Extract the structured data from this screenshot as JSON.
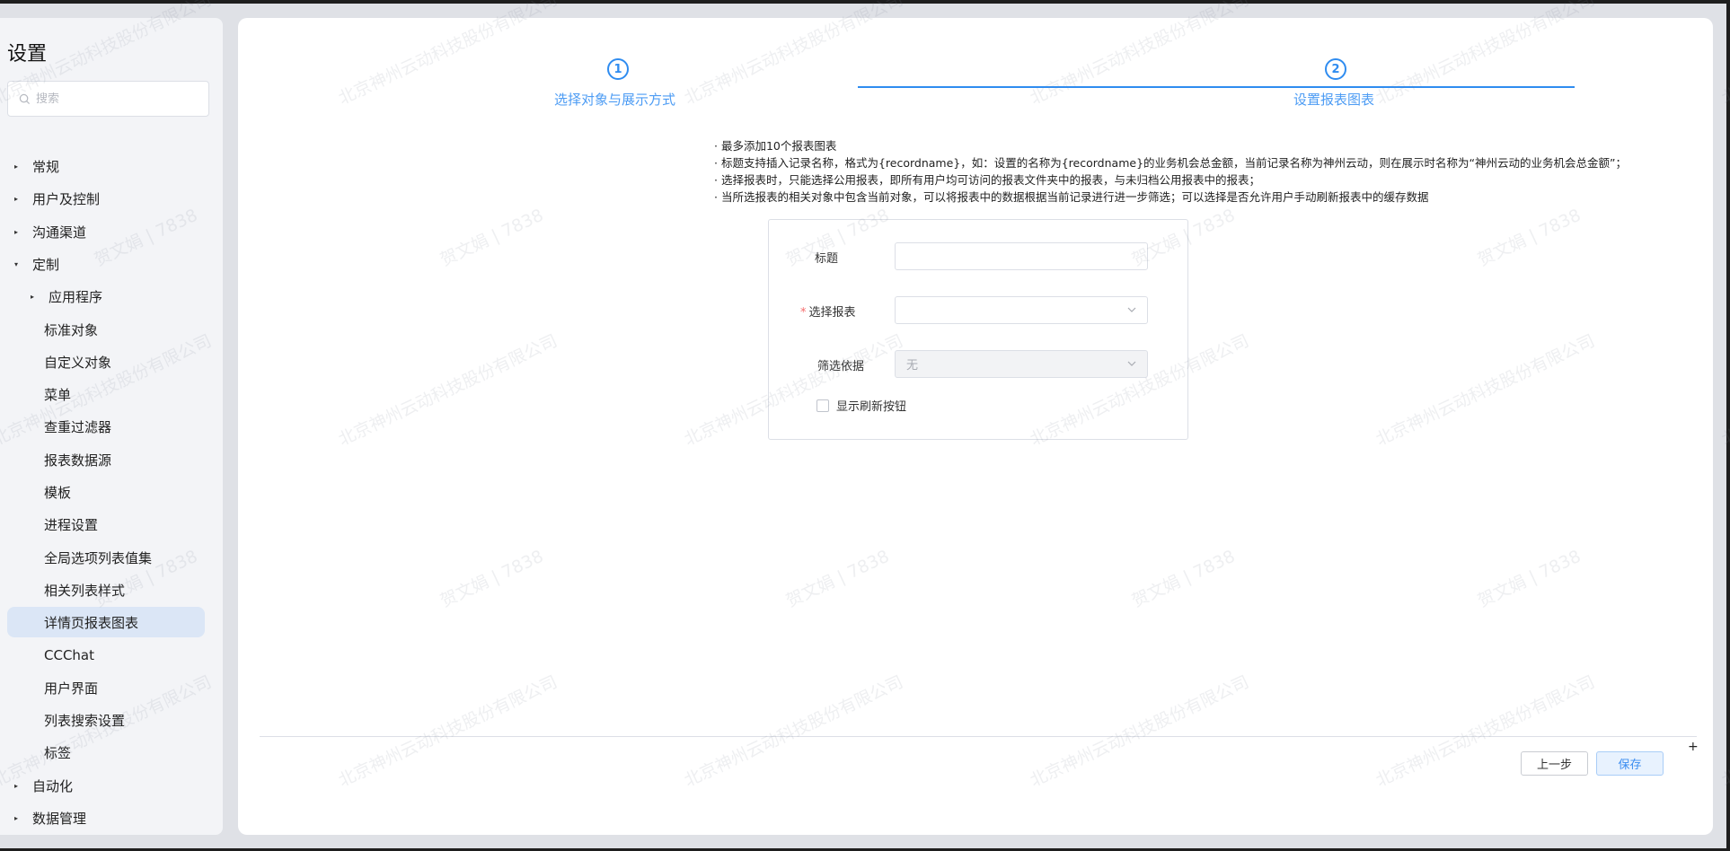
{
  "sidebar": {
    "title": "设置",
    "search_placeholder": "搜索",
    "items": [
      {
        "label": "常规",
        "caret": "▸"
      },
      {
        "label": "用户及控制",
        "caret": "▸"
      },
      {
        "label": "沟通渠道",
        "caret": "▸"
      },
      {
        "label": "定制",
        "caret": "▾"
      },
      {
        "label": "应用程序",
        "caret": "▸"
      },
      {
        "label": "标准对象",
        "caret": ""
      },
      {
        "label": "自定义对象",
        "caret": ""
      },
      {
        "label": "菜单",
        "caret": ""
      },
      {
        "label": "查重过滤器",
        "caret": ""
      },
      {
        "label": "报表数据源",
        "caret": ""
      },
      {
        "label": "模板",
        "caret": ""
      },
      {
        "label": "进程设置",
        "caret": ""
      },
      {
        "label": "全局选项列表值集",
        "caret": ""
      },
      {
        "label": "相关列表样式",
        "caret": ""
      },
      {
        "label": "详情页报表图表",
        "caret": "",
        "active": true
      },
      {
        "label": "CCChat",
        "caret": ""
      },
      {
        "label": "用户界面",
        "caret": ""
      },
      {
        "label": "列表搜索设置",
        "caret": ""
      },
      {
        "label": "标签",
        "caret": ""
      },
      {
        "label": "自动化",
        "caret": "▸"
      },
      {
        "label": "数据管理",
        "caret": "▸"
      }
    ]
  },
  "steps": [
    {
      "number": "1",
      "label": "选择对象与展示方式"
    },
    {
      "number": "2",
      "label": "设置报表图表"
    }
  ],
  "notes": [
    "· 最多添加10个报表图表",
    "· 标题支持插入记录名称，格式为{recordname}，如：设置的名称为{recordname}的业务机会总金额，当前记录名称为神州云动，则在展示时名称为“神州云动的业务机会总金额”；",
    "· 选择报表时，只能选择公用报表，即所有用户均可访问的报表文件夹中的报表，与未归档公用报表中的报表；",
    "· 当所选报表的相关对象中包含当前对象，可以将报表中的数据根据当前记录进行进一步筛选；可以选择是否允许用户手动刷新报表中的缓存数据"
  ],
  "form": {
    "title_label": "标题",
    "title_value": "",
    "report_required_mark": "*",
    "report_label": "选择报表",
    "report_value": "",
    "filter_label": "筛选依据",
    "filter_value": "无",
    "refresh_label": "显示刷新按钮",
    "refresh_checked": false
  },
  "footer": {
    "plus": "+",
    "prev_label": "上一步",
    "save_label": "保存"
  },
  "watermark": {
    "company": "北京神州云动科技股份有限公司",
    "user": "贺文娟 | 7838"
  },
  "colors": {
    "accent": "#2f8cf0",
    "required": "#f56c6c",
    "active_nav_bg": "#dbe6f6"
  }
}
